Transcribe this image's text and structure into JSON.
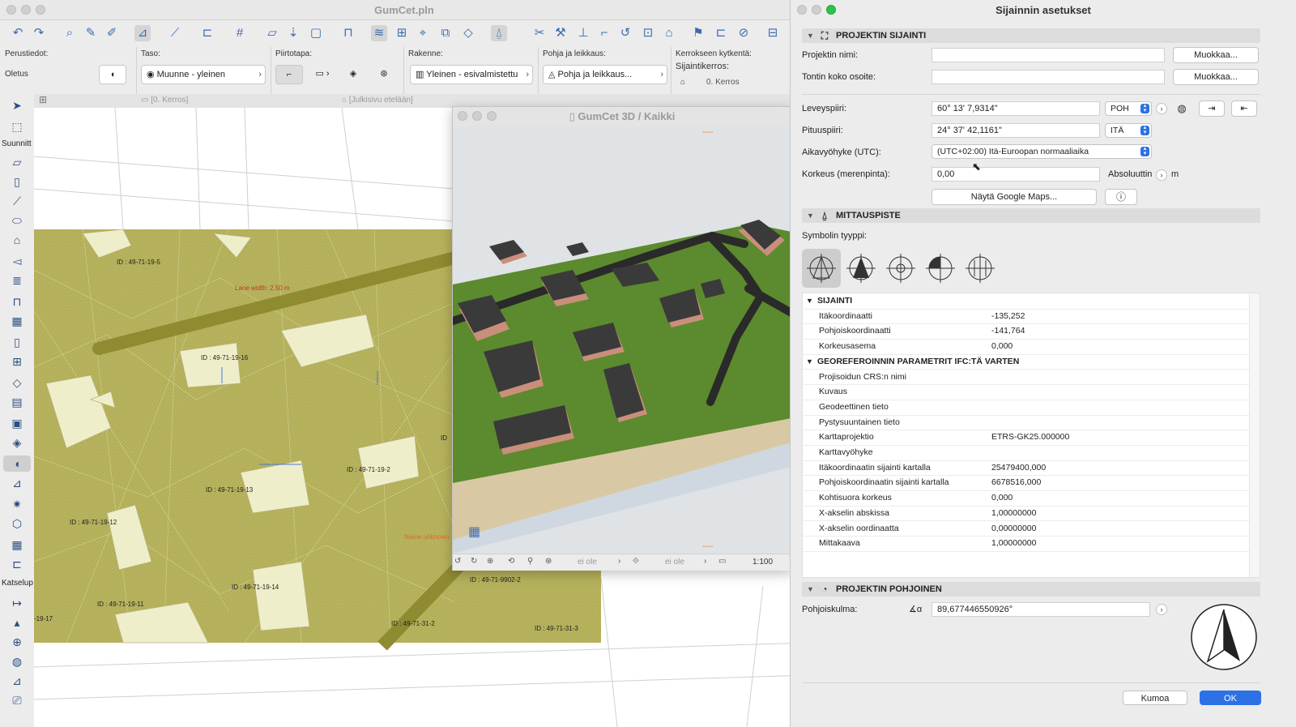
{
  "main_window": {
    "title": "GumCet.pln"
  },
  "info_box": {
    "perustiedot_label": "Perustiedot:",
    "perustiedot_value": "Oletus",
    "taso_label": "Taso:",
    "taso_value": "Muunne - yleinen",
    "piirtotapa_label": "Piirtotapa:",
    "rakenne_label": "Rakenne:",
    "rakenne_value": "Yleinen - esivalmistettu",
    "pohja_label": "Pohja ja leikkaus:",
    "pohja_value": "Pohja ja leikkaus...",
    "kerros_label": "Kerrokseen kytkentä:",
    "sijaintikerros_label": "Sijaintikerros:",
    "sijaintikerros_value": "0. Kerros"
  },
  "toolbox": {
    "group_design": "Suunnitt",
    "group_view": "Katselup"
  },
  "view_tabs": {
    "tab1": "[0. Kerros]",
    "tab2": "[Julkisivu etelään]"
  },
  "plan_labels": {
    "l1": "ID : 49-71-19-5",
    "l2": "Lane width: 2.50 m",
    "l3": "ID : 49-71-19-16",
    "l4": "ID : 49-71-19-2",
    "l5": "ID : 49-71-19-13",
    "l6": "ID : 49-71-19-12",
    "l7": "ID : 49-71-19-14",
    "l8": "ID : 49-71-19-11",
    "l9": "ID : 49-71-9902-2",
    "l10": "ID : 49-71-31-2",
    "l11": "ID : 49-71-31-3",
    "l12": "-19-17",
    "l13": "Name unknown",
    "l14": "ID"
  },
  "win3d": {
    "title": "GumCet 3D / Kaikki",
    "nav1": "ei ole",
    "nav2": "ei ole",
    "scale": "1:100",
    "marker": "----"
  },
  "dialog": {
    "title": "Sijainnin asetukset",
    "sec_project": "PROJEKTIN SIJAINTI",
    "project_name_label": "Projektin nimi:",
    "project_name_value": "",
    "edit1": "Muokkaa...",
    "address_label": "Tontin koko osoite:",
    "address_value": "",
    "edit2": "Muokkaa...",
    "lat_label": "Leveyspiiri:",
    "lat_value": "60° 13' 7,9314\"",
    "lat_dir": "POH",
    "lon_label": "Pituuspiiri:",
    "lon_value": "24° 37' 42,1161\"",
    "lon_dir": "ITÄ",
    "tz_label": "Aikavyöhyke (UTC):",
    "tz_value": "(UTC+02:00) Itä-Euroopan normaaliaika",
    "alt_label": "Korkeus (merenpinta):",
    "alt_value": "0,00",
    "alt_mode": "Absoluuttin",
    "alt_unit": "m",
    "maps_button": "Näytä Google Maps...",
    "sec_survey": "MITTAUSPISTE",
    "symbol_type_label": "Symbolin tyyppi:",
    "tree_group1": "SIJAINTI",
    "tree1": [
      {
        "k": "Itäkoordinaatti",
        "v": "-135,252"
      },
      {
        "k": "Pohjoiskoordinaatti",
        "v": "-141,764"
      },
      {
        "k": "Korkeusasema",
        "v": "0,000"
      }
    ],
    "tree_group2": "GEOREFEROINNIN PARAMETRIT IFC:TÄ VARTEN",
    "tree2": [
      {
        "k": "Projisoidun CRS:n nimi",
        "v": ""
      },
      {
        "k": "Kuvaus",
        "v": ""
      },
      {
        "k": "Geodeettinen tieto",
        "v": ""
      },
      {
        "k": "Pystysuuntainen tieto",
        "v": ""
      },
      {
        "k": "Karttaprojektio",
        "v": "ETRS-GK25.000000"
      },
      {
        "k": "Karttavyöhyke",
        "v": ""
      },
      {
        "k": "Itäkoordinaatin sijainti kartalla",
        "v": "25479400,000"
      },
      {
        "k": "Pohjoiskoordinaatin sijainti kartalla",
        "v": "6678516,000"
      },
      {
        "k": "Kohtisuora korkeus",
        "v": "0,000"
      },
      {
        "k": "X-akselin abskissa",
        "v": "1,00000000"
      },
      {
        "k": "X-akselin oordinaatta",
        "v": "0,00000000"
      },
      {
        "k": "Mittakaava",
        "v": "1,00000000"
      }
    ],
    "sec_north": "PROJEKTIN POHJOINEN",
    "north_label": "Pohjoiskulma:",
    "north_value": "89,677446550926°",
    "cancel": "Kumoa",
    "ok": "OK"
  },
  "colors": {
    "accent": "#2c72e6",
    "terrain_plan": "#b9b560",
    "terrain_3d": "#5c8a2e",
    "roof": "#3a3a3a",
    "wall": "#c98f7a"
  }
}
